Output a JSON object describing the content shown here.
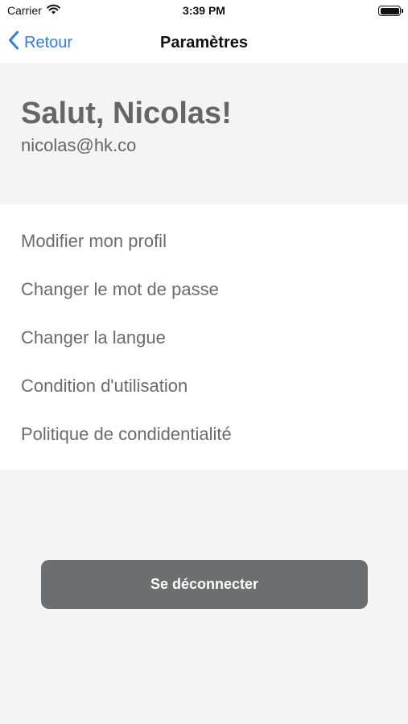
{
  "status_bar": {
    "carrier": "Carrier",
    "time": "3:39 PM",
    "wifi_icon": "wifi-icon",
    "battery_icon": "battery-icon"
  },
  "nav": {
    "back_label": "Retour",
    "back_icon": "chevron-left-icon",
    "title": "Paramètres",
    "accent_color": "#2f7cf6"
  },
  "profile": {
    "greeting": "Salut, Nicolas!",
    "email": "nicolas@hk.co"
  },
  "menu": {
    "items": [
      {
        "label": "Modifier mon profil"
      },
      {
        "label": "Changer le mot de passe"
      },
      {
        "label": "Changer la langue"
      },
      {
        "label": "Condition d'utilisation"
      },
      {
        "label": "Politique de condidentialité"
      }
    ]
  },
  "logout": {
    "label": "Se déconnecter",
    "color": "#6d6e70"
  }
}
